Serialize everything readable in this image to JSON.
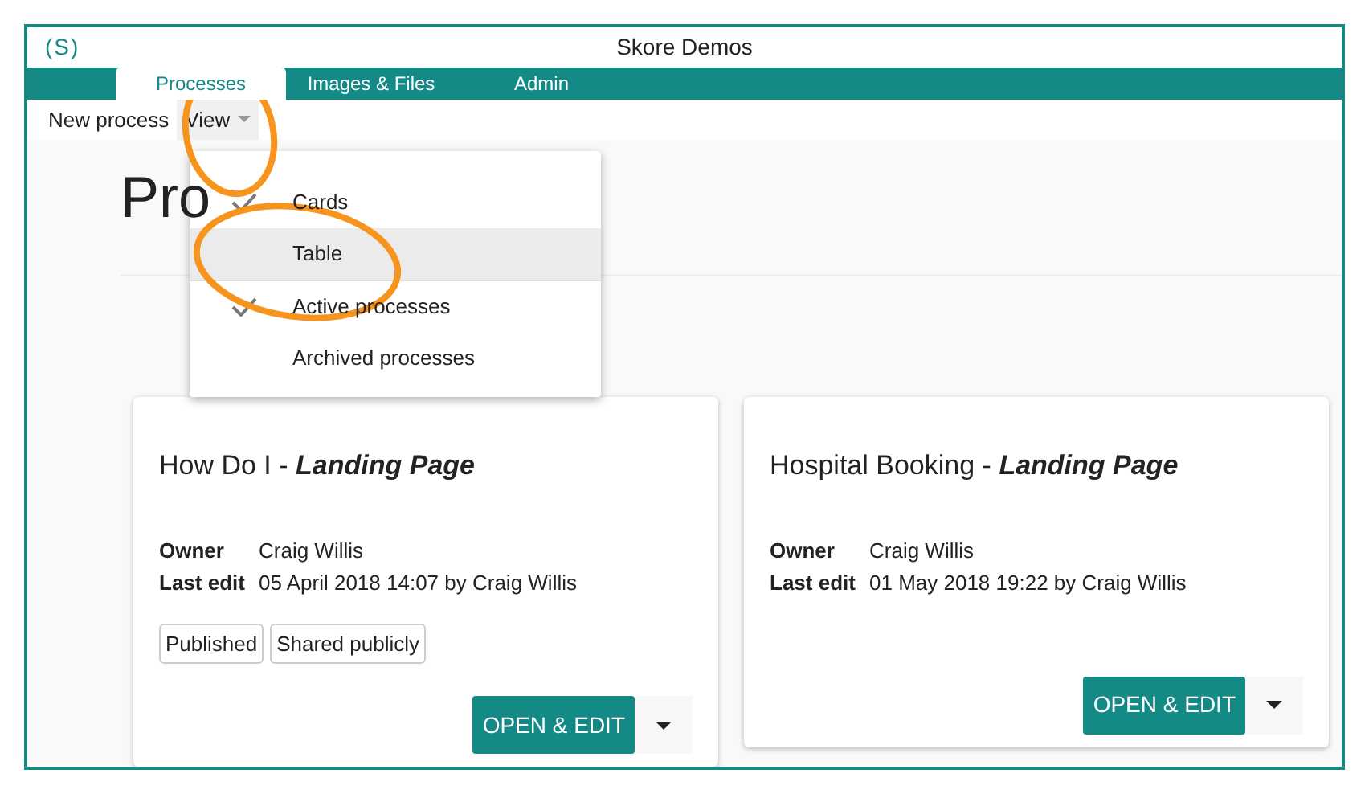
{
  "app": {
    "logo": "(S)",
    "title": "Skore Demos"
  },
  "tabs": [
    {
      "label": "Processes",
      "selected": true
    },
    {
      "label": "Images & Files",
      "selected": false
    },
    {
      "label": "Admin",
      "selected": false
    }
  ],
  "toolbar": [
    {
      "label": "New process",
      "kind": "button",
      "expanded": false
    },
    {
      "label": "View",
      "kind": "dropdown",
      "expanded": true
    }
  ],
  "heading": "Pro",
  "view_menu": [
    {
      "label": "Cards",
      "checked": true,
      "highlighted": false,
      "divider_after": false
    },
    {
      "label": "Table",
      "checked": false,
      "highlighted": true,
      "divider_after": true
    },
    {
      "label": "Active processes",
      "checked": true,
      "highlighted": false,
      "divider_after": false
    },
    {
      "label": "Archived processes",
      "checked": false,
      "highlighted": false,
      "divider_after": false
    }
  ],
  "cards": [
    {
      "title": "How Do I - ",
      "title_emphasis": "Landing Page",
      "meta": [
        {
          "label": "Owner",
          "value": "Craig Willis"
        },
        {
          "label": "Last edit",
          "value": "05 April 2018 14:07 by Craig Willis"
        }
      ],
      "tags": [
        "Published",
        "Shared publicly"
      ],
      "button": "OPEN & EDIT"
    },
    {
      "title": "Hospital Booking - ",
      "title_emphasis": "Landing Page",
      "meta": [
        {
          "label": "Owner",
          "value": "Craig Willis"
        },
        {
          "label": "Last edit",
          "value": "01 May 2018 19:22 by Craig Willis"
        }
      ],
      "button": "OPEN & EDIT"
    }
  ]
}
